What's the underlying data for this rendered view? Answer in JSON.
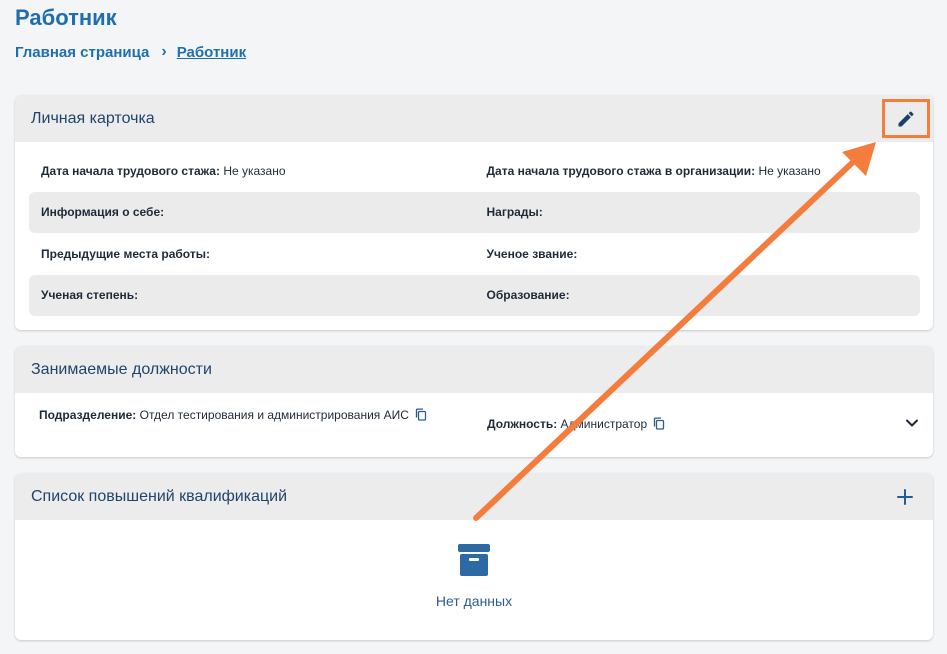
{
  "page": {
    "title": "Работник",
    "breadcrumb": {
      "home": "Главная страница",
      "separator": "›",
      "current": "Работник"
    }
  },
  "personal_card": {
    "title": "Личная карточка",
    "edit_icon": "pencil-icon",
    "rows": [
      {
        "left_label": "Дата начала трудового стажа:",
        "left_value": "Не указано",
        "right_label": "Дата начала трудового стажа в организации:",
        "right_value": "Не указано"
      },
      {
        "left_label": "Информация о себе:",
        "left_value": "",
        "right_label": "Награды:",
        "right_value": ""
      },
      {
        "left_label": "Предыдущие места работы:",
        "left_value": "",
        "right_label": "Ученое звание:",
        "right_value": ""
      },
      {
        "left_label": "Ученая степень:",
        "left_value": "",
        "right_label": "Образование:",
        "right_value": ""
      }
    ]
  },
  "positions_card": {
    "title": "Занимаемые должности",
    "department_label": "Подразделение:",
    "department_value": "Отдел тестирования и администрирования АИС",
    "position_label": "Должность:",
    "position_value": "Администратор"
  },
  "qualifications_card": {
    "title": "Список повышений квалификаций",
    "empty_text": "Нет данных",
    "add_icon": "plus-icon"
  },
  "colors": {
    "accent": "#1f6fb0",
    "highlight": "#f47c3c",
    "header_bg": "#ececec"
  }
}
